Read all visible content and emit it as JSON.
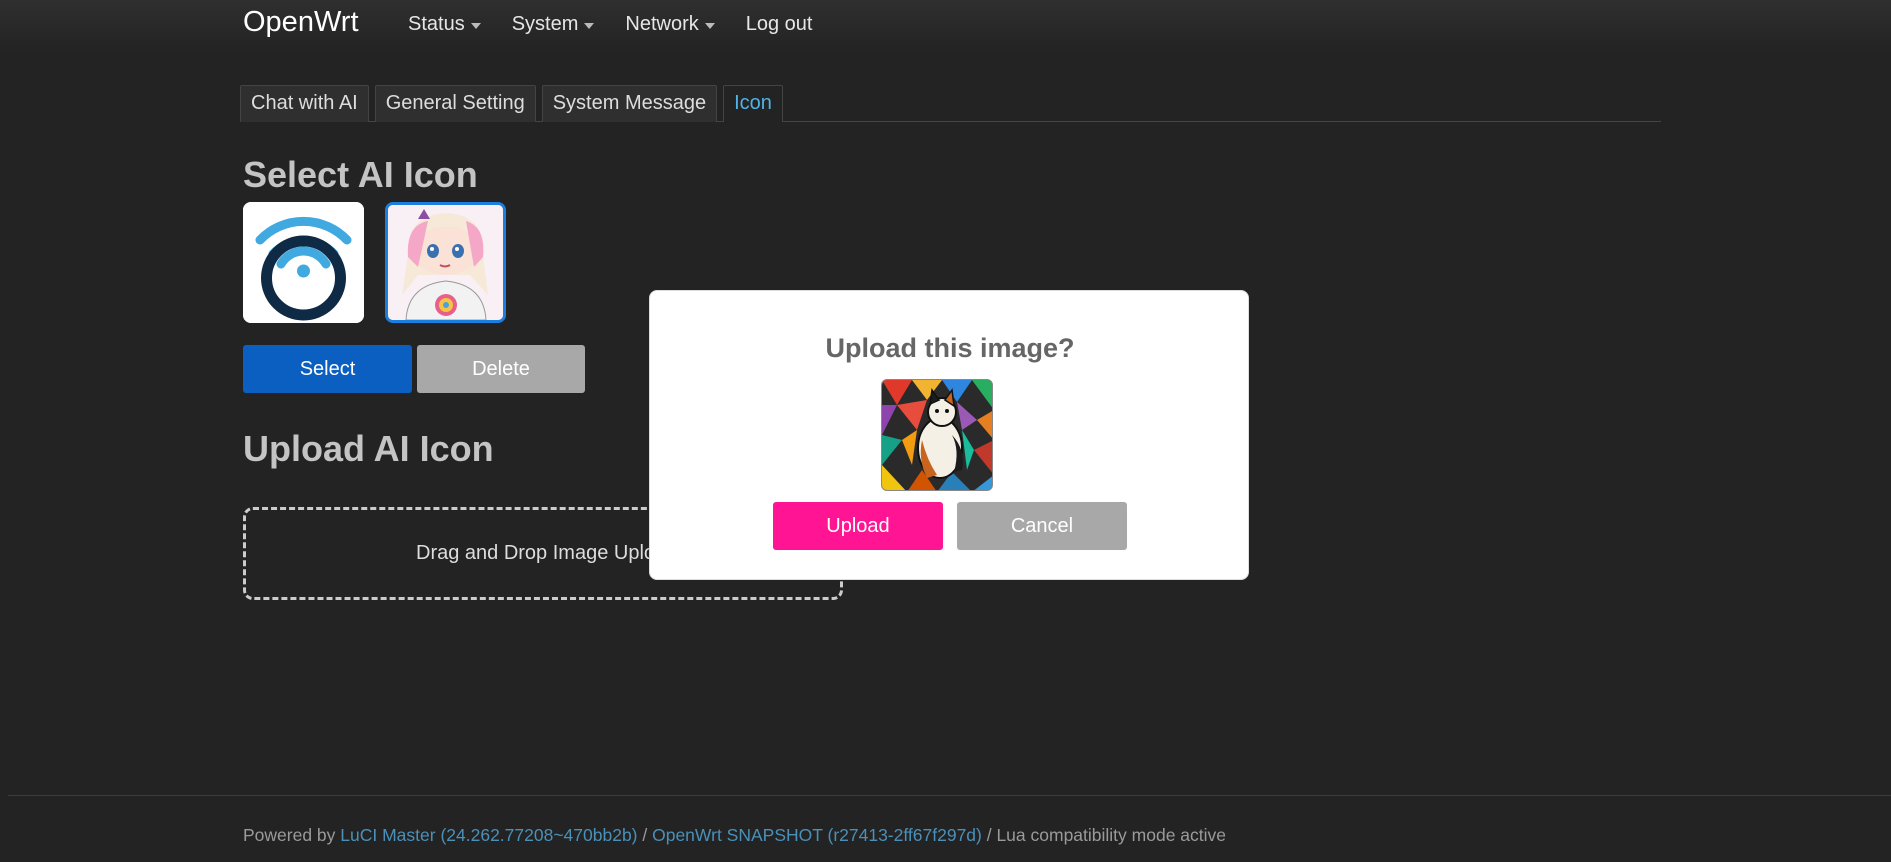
{
  "header": {
    "brand": "OpenWrt",
    "nav": [
      {
        "label": "Status",
        "dropdown": true
      },
      {
        "label": "System",
        "dropdown": true
      },
      {
        "label": "Network",
        "dropdown": true
      },
      {
        "label": "Log out",
        "dropdown": false
      }
    ]
  },
  "tabs": [
    {
      "label": "Chat with AI",
      "active": false
    },
    {
      "label": "General Setting",
      "active": false
    },
    {
      "label": "System Message",
      "active": false
    },
    {
      "label": "Icon",
      "active": true
    }
  ],
  "select_section": {
    "title": "Select AI Icon",
    "icons": [
      {
        "name": "wifi-logo-icon",
        "selected": false
      },
      {
        "name": "anime-girl-icon",
        "selected": true
      }
    ],
    "select_label": "Select",
    "delete_label": "Delete"
  },
  "upload_section": {
    "title": "Upload AI Icon",
    "dropzone_text": "Drag and Drop Image Uplo"
  },
  "modal": {
    "title": "Upload this image?",
    "preview_icon": "stained-glass-cat-icon",
    "upload_label": "Upload",
    "cancel_label": "Cancel"
  },
  "footer": {
    "prefix": "Powered by ",
    "luci_link": "LuCI Master (24.262.77208~470bb2b)",
    "sep": " / ",
    "openwrt_link": "OpenWrt SNAPSHOT (r27413-2ff67f297d)",
    "suffix": " / Lua compatibility mode active"
  },
  "colors": {
    "background": "#232323",
    "accent_blue": "#0a5fc0",
    "tab_active": "#4fb3e8",
    "upload_pink": "#ff1493",
    "cancel_gray": "#a8a8a8"
  }
}
